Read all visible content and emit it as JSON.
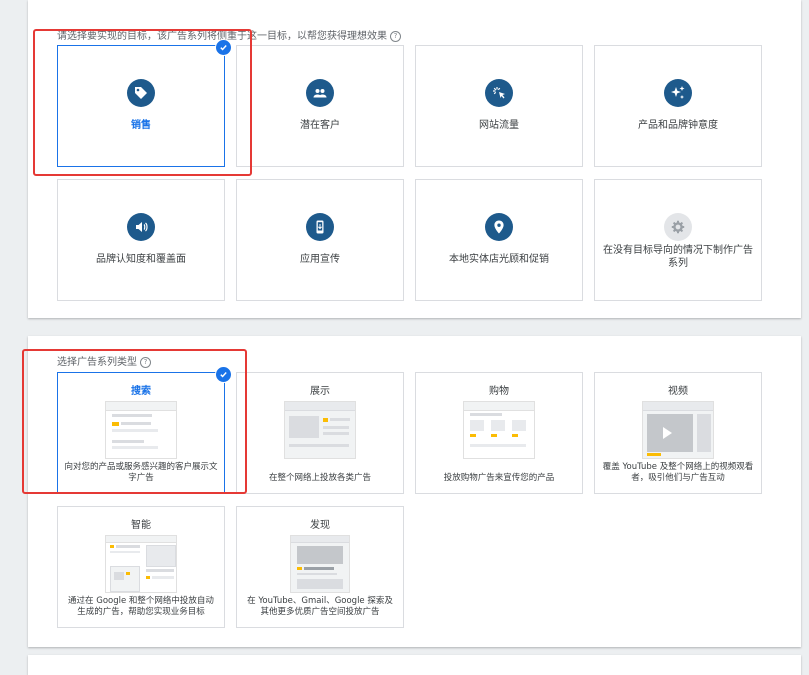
{
  "goal_section": {
    "heading": "请选择要实现的目标，该广告系列将侧重于这一目标，以帮您获得理想效果",
    "cards": [
      {
        "label": "销售",
        "icon": "tag-icon",
        "selected": true
      },
      {
        "label": "潜在客户",
        "icon": "people-icon",
        "selected": false
      },
      {
        "label": "网站流量",
        "icon": "cursor-click-icon",
        "selected": false
      },
      {
        "label": "产品和品牌钟意度",
        "icon": "sparkle-icon",
        "selected": false
      },
      {
        "label": "品牌认知度和覆盖面",
        "icon": "megaphone-icon",
        "selected": false
      },
      {
        "label": "应用宣传",
        "icon": "phone-icon",
        "selected": false
      },
      {
        "label": "本地实体店光顾和促销",
        "icon": "location-pin-icon",
        "selected": false
      },
      {
        "label": "在没有目标导向的情况下制作广告系列",
        "icon": "gear-icon",
        "selected": false
      }
    ]
  },
  "type_section": {
    "heading": "选择广告系列类型",
    "cards": [
      {
        "title": "搜索",
        "desc": "向对您的产品或服务感兴趣的客户展示文字广告",
        "selected": true
      },
      {
        "title": "展示",
        "desc": "在整个网络上投放各类广告",
        "selected": false
      },
      {
        "title": "购物",
        "desc": "投放购物广告来宣传您的产品",
        "selected": false
      },
      {
        "title": "视频",
        "desc": "覆盖 YouTube 及整个网络上的视频观看者，吸引他们与广告互动",
        "selected": false
      },
      {
        "title": "智能",
        "desc": "通过在 Google 和整个网络中投放自动生成的广告，帮助您实现业务目标",
        "selected": false
      },
      {
        "title": "发现",
        "desc": "在 YouTube、Gmail、Google 探索及其他更多优质广告空间投放广告",
        "selected": false
      }
    ]
  },
  "colors": {
    "accent": "#1a73e8",
    "icon_bg": "#1e5a8c",
    "highlight": "#e53935",
    "thumb_yellow": "#fbbc04"
  }
}
